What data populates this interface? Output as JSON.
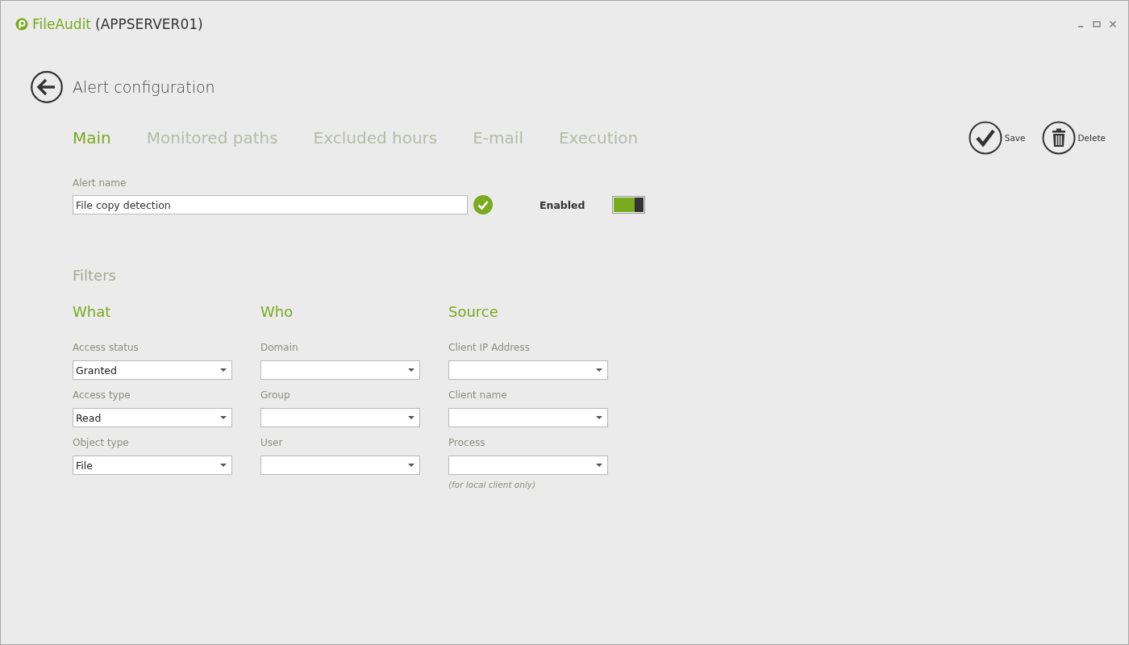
{
  "window": {
    "app_name": "FileAudit",
    "server": "(APPSERVER01)"
  },
  "page_title": "Alert configuration",
  "tabs": [
    {
      "label": "Main",
      "selected": true
    },
    {
      "label": "Monitored paths",
      "selected": false
    },
    {
      "label": "Excluded hours",
      "selected": false
    },
    {
      "label": "E-mail",
      "selected": false
    },
    {
      "label": "Execution",
      "selected": false
    }
  ],
  "actions": [
    {
      "kind": "save",
      "label": "Save"
    },
    {
      "kind": "delete",
      "label": "Delete"
    }
  ],
  "alert_name": {
    "label": "Alert name",
    "value": "File copy detection",
    "valid": true
  },
  "enabled": {
    "label": "Enabled",
    "on": true
  },
  "filters": {
    "title": "Filters",
    "groups": [
      {
        "title": "What",
        "fields": [
          {
            "label": "Access status",
            "value": "Granted"
          },
          {
            "label": "Access type",
            "value": "Read"
          },
          {
            "label": "Object type",
            "value": "File"
          }
        ]
      },
      {
        "title": "Who",
        "fields": [
          {
            "label": "Domain"
          },
          {
            "label": "Group"
          },
          {
            "label": "User"
          }
        ]
      },
      {
        "title": "Source",
        "fields": [
          {
            "label": "Client IP Address"
          },
          {
            "label": "Client name"
          },
          {
            "label": "Process",
            "note": "(for local client only)"
          }
        ]
      }
    ]
  }
}
